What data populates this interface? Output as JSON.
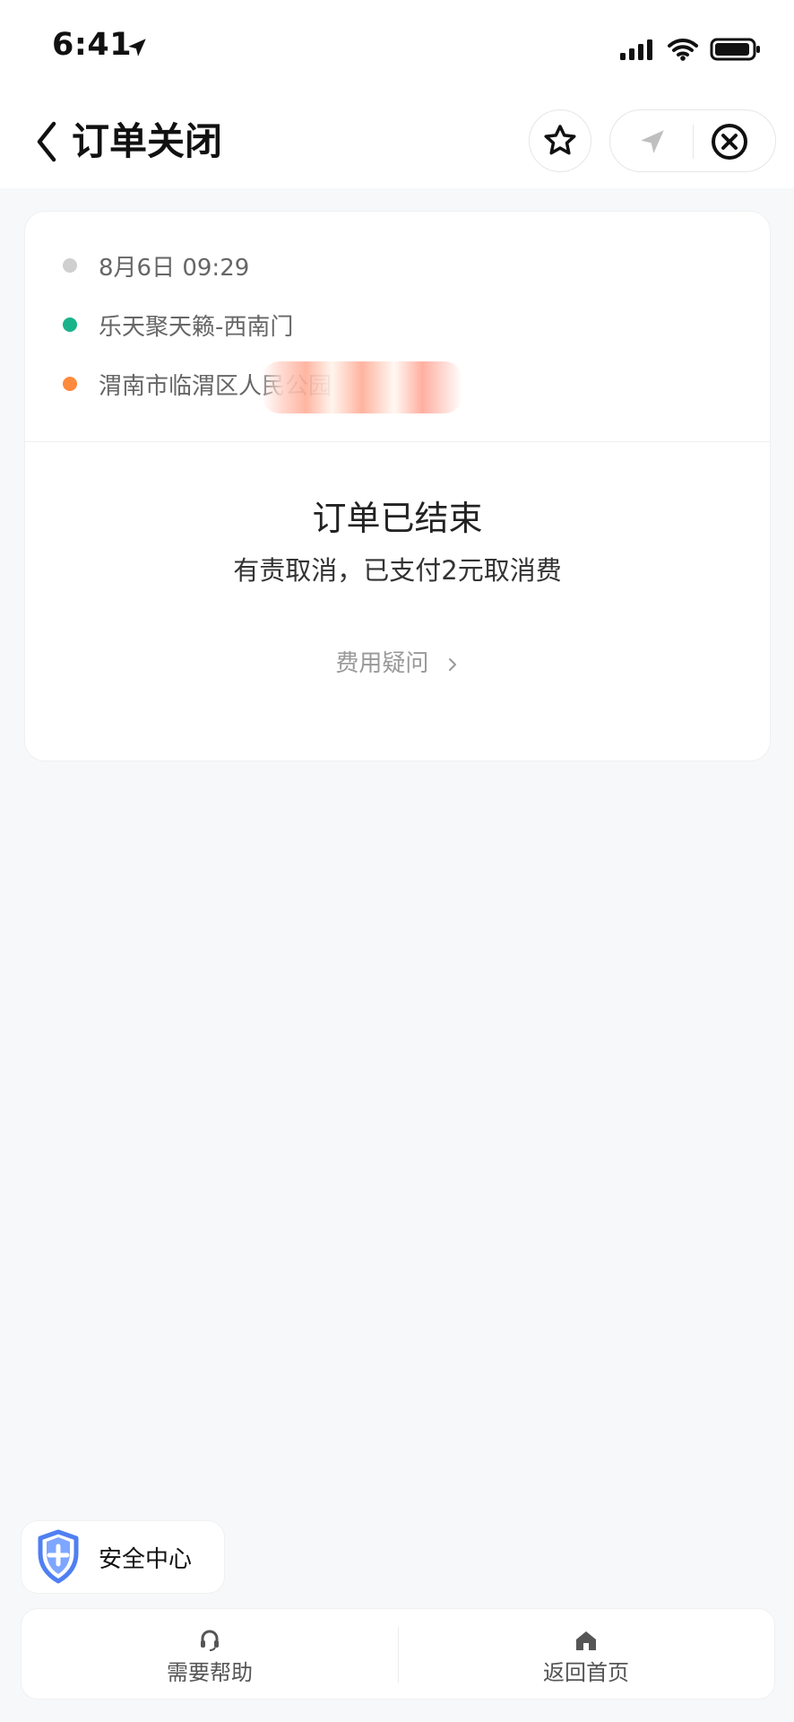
{
  "status_bar": {
    "time": "6:41"
  },
  "nav": {
    "title": "订单关闭",
    "icons": {
      "back": "chevron-left-icon",
      "favorite": "star-icon",
      "location": "navigation-icon",
      "close": "close-circle-icon"
    }
  },
  "trip": {
    "time_text": "8月6日 09:29",
    "start_location": "乐天聚天籁-西南门",
    "end_location_visible": "渭南市临渭区人民公园",
    "colors": {
      "time_dot": "#cfcfcf",
      "start_dot": "#19b38a",
      "end_dot": "#ff8a3d"
    }
  },
  "order_status": {
    "title": "订单已结束",
    "subtitle": "有责取消，已支付2元取消费",
    "fee_question": "费用疑问"
  },
  "safety": {
    "label": "安全中心",
    "icon": "shield-plus-icon"
  },
  "bottom_actions": {
    "help": {
      "label": "需要帮助",
      "icon": "headset-icon"
    },
    "home": {
      "label": "返回首页",
      "icon": "home-icon"
    }
  }
}
